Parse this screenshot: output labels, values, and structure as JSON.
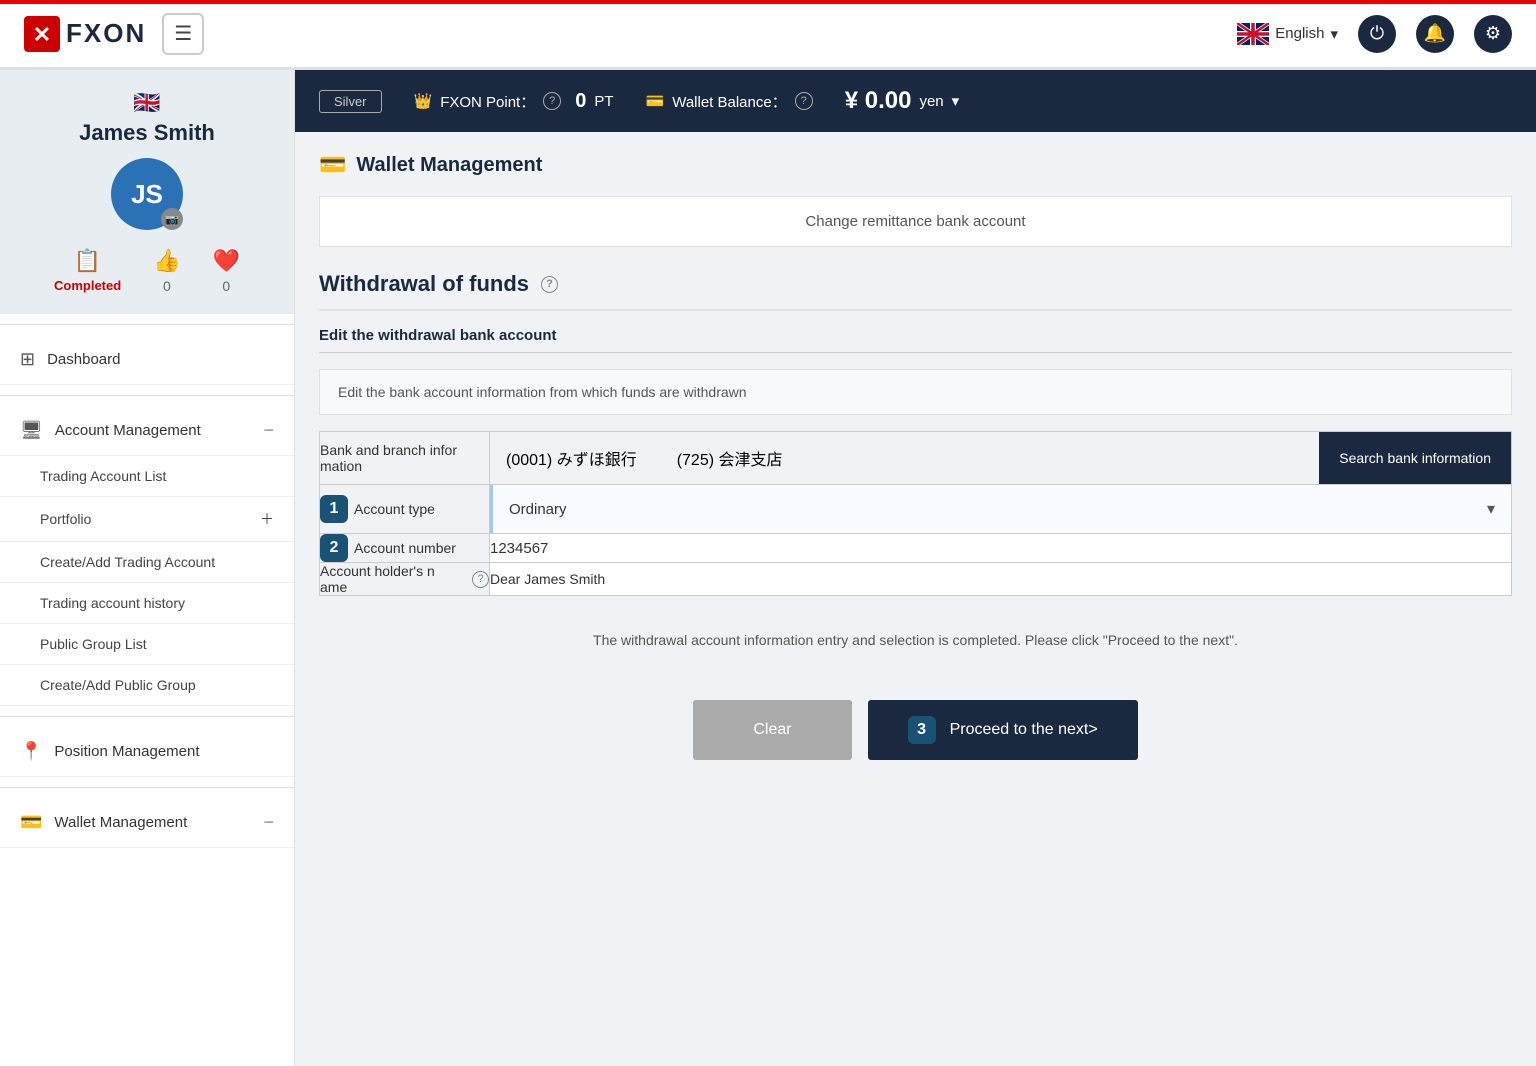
{
  "app": {
    "logo": "FXON",
    "logo_x": "✕"
  },
  "navbar": {
    "hamburger_label": "☰",
    "language": "English",
    "language_chevron": "▾",
    "power_icon": "⏻",
    "bell_icon": "🔔",
    "gear_icon": "⚙"
  },
  "account_bar": {
    "silver_label": "Silver",
    "fxon_point_label": "FXON Point：",
    "fxon_point_value": "0",
    "fxon_point_unit": "PT",
    "wallet_balance_label": "Wallet Balance：",
    "wallet_balance_value": "¥  0.00",
    "wallet_balance_unit": "yen",
    "wallet_balance_chevron": "▾"
  },
  "user": {
    "flag": "🇬🇧",
    "name": "James Smith",
    "initials": "JS",
    "completed_label": "Completed",
    "likes_count": "0",
    "hearts_count": "0"
  },
  "sidebar": {
    "dashboard_label": "Dashboard",
    "account_management_label": "Account Management",
    "trading_account_list_label": "Trading Account List",
    "portfolio_label": "Portfolio",
    "create_add_trading_account_label": "Create/Add Trading Account",
    "trading_account_history_label": "Trading account history",
    "public_group_list_label": "Public Group List",
    "create_add_public_group_label": "Create/Add Public Group",
    "position_management_label": "Position Management",
    "wallet_management_label": "Wallet Management"
  },
  "main": {
    "wallet_management_title": "Wallet Management",
    "remittance_label": "Change remittance bank account",
    "withdrawal_title": "Withdrawal of funds",
    "edit_bank_account_title": "Edit the withdrawal bank account",
    "info_box_text": "Edit the bank account information from which funds are withdrawn",
    "bank_branch_label": "Bank and branch infor mation",
    "bank_value_code": "(0001) みずほ銀行",
    "bank_value_branch": "(725) 会津支店",
    "search_bank_btn": "Search bank information",
    "account_type_label": "Account type",
    "account_type_value": "Ordinary",
    "account_number_label": "Account number",
    "account_number_value": "1234567",
    "account_holder_label": "Account holder's n ame",
    "account_holder_value": "Dear James Smith",
    "completion_message": "The withdrawal account information entry and selection is completed. Please click \"Proceed to the next\".",
    "clear_btn": "Clear",
    "proceed_btn": "Proceed to the next>",
    "step1_label": "1",
    "step2_label": "2",
    "step3_label": "3"
  }
}
